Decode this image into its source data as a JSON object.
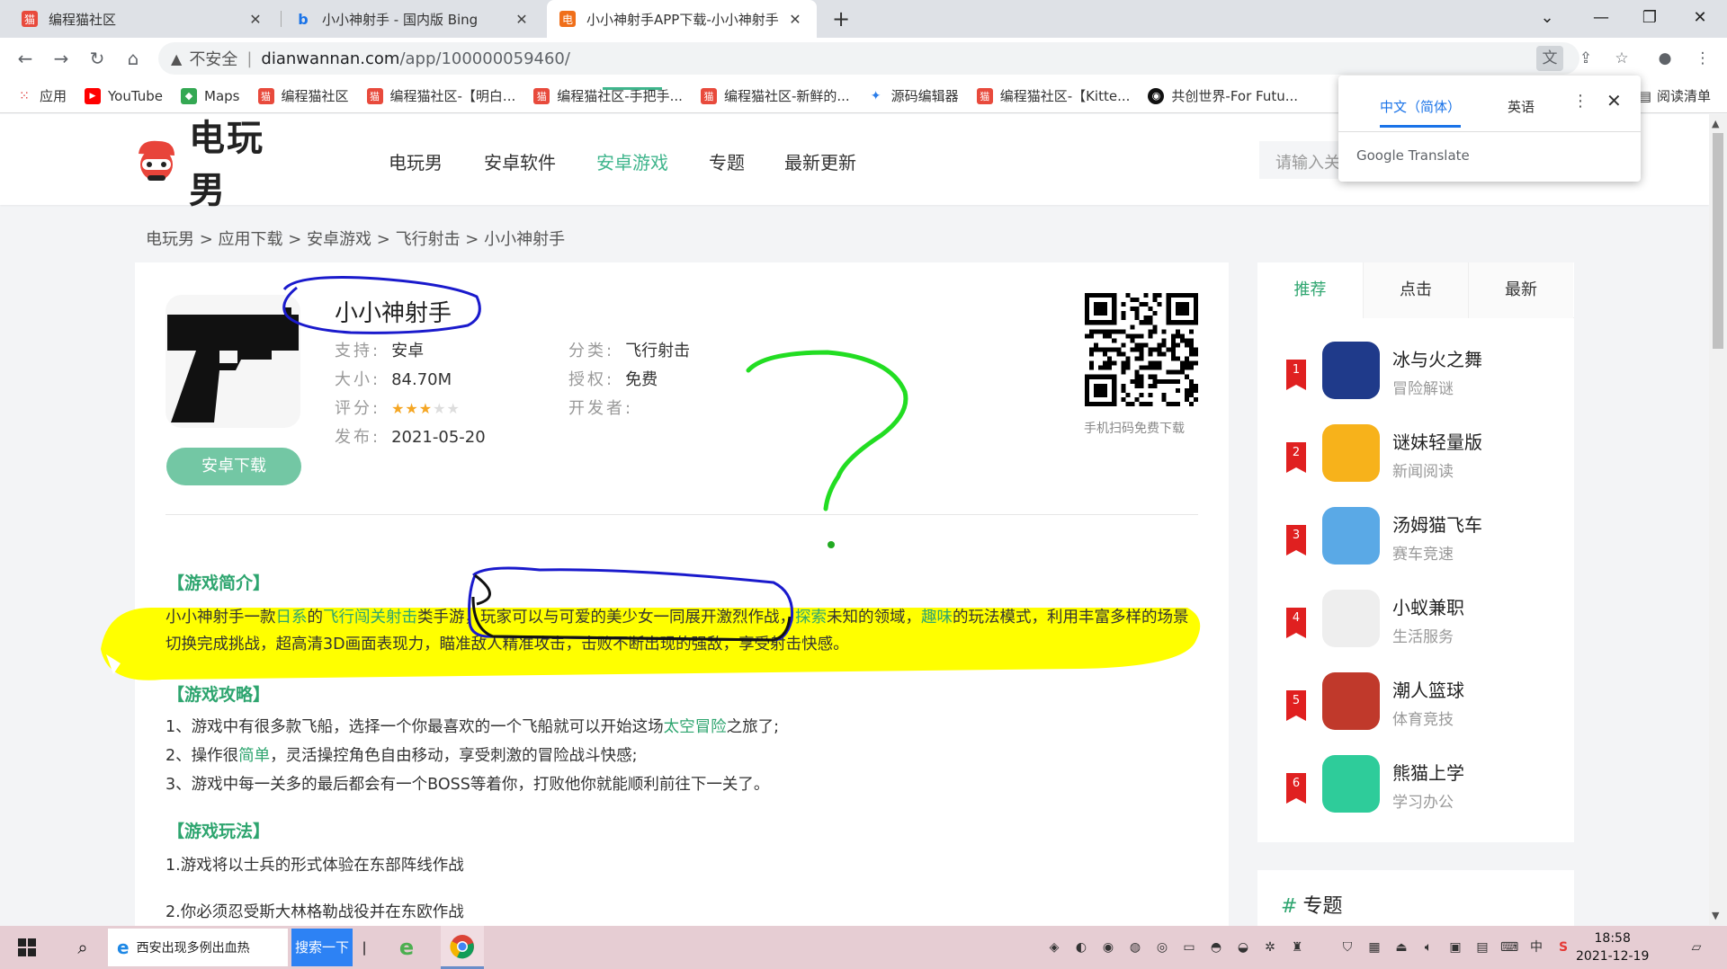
{
  "browser": {
    "tabs": [
      {
        "title": "编程猫社区",
        "active": false
      },
      {
        "title": "小小神射手 - 国内版 Bing",
        "active": false
      },
      {
        "title": "小小神射手APP下载-小小神射手",
        "active": true
      }
    ],
    "address": {
      "insecure_label": "不安全",
      "host": "dianwannan.com",
      "path": "/app/100000059460/"
    },
    "bookmarks": [
      {
        "label": "应用",
        "icon": "apps-grid-icon"
      },
      {
        "label": "YouTube",
        "icon": "youtube-icon"
      },
      {
        "label": "Maps",
        "icon": "maps-icon"
      },
      {
        "label": "编程猫社区",
        "icon": "codemao-icon"
      },
      {
        "label": "编程猫社区-【明白...",
        "icon": "codemao-icon"
      },
      {
        "label": "编程猫社区-手把手...",
        "icon": "codemao-icon"
      },
      {
        "label": "编程猫社区-新鲜的...",
        "icon": "codemao-icon"
      },
      {
        "label": "源码编辑器",
        "icon": "code-editor-icon"
      },
      {
        "label": "编程猫社区-【Kitte...",
        "icon": "codemao-icon"
      },
      {
        "label": "共创世界-For Futu...",
        "icon": "world-icon"
      }
    ],
    "reading_list": "阅读清单"
  },
  "translate_popup": {
    "tab_source": "中文（简体）",
    "tab_target": "英语",
    "brand": "Google Translate"
  },
  "site": {
    "logo_text": "电玩男",
    "nav": [
      "电玩男",
      "安卓软件",
      "安卓游戏",
      "专题",
      "最新更新"
    ],
    "active_nav": "安卓游戏",
    "search_placeholder": "请输入关"
  },
  "breadcrumb": "电玩男 > 应用下载 > 安卓游戏 > 飞行射击 > 小小神射手",
  "app": {
    "title": "小小神射手",
    "support_label": "支持:",
    "support": "安卓",
    "size_label": "大小:",
    "size": "84.70M",
    "rating_label": "评分:",
    "rating": 3,
    "rating_max": 5,
    "release_label": "发布:",
    "release": "2021-05-20",
    "category_label": "分类:",
    "category": "飞行射击",
    "license_label": "授权:",
    "license": "免费",
    "developer_label": "开发者:",
    "developer": "",
    "download_button": "安卓下载",
    "qr_caption": "手机扫码免费下载"
  },
  "content": {
    "intro_title": "【游戏简介】",
    "intro_p1": {
      "a": "小小神射手一款",
      "b": "日系",
      "c": "的",
      "d": "飞行闯关射击",
      "e": "类手游，玩家可以与可爱的美少女一同展开激烈作战，",
      "f": "探索",
      "g": "未知的领域，",
      "h": "趣味",
      "i": "的玩法模式，利用丰富多样的场景"
    },
    "intro_p2": "切换完成挑战，超高清3D画面表现力，瞄准敌人精准攻击，击败不断出现的强敌，享受射击快感。",
    "guide_title": "【游戏攻略】",
    "guide_1": {
      "a": "1、游戏中有很多款飞船，选择一个你最喜欢的一个飞船就可以开始这场",
      "b": "太空冒险",
      "c": "之旅了;"
    },
    "guide_2": {
      "a": "2、操作很",
      "b": "简单",
      "c": "，灵活操控角色自由移动，享受刺激的冒险战斗快感;"
    },
    "guide_3": "3、游戏中每一关多的最后都会有一个BOSS等着你，打败他你就能顺利前往下一关了。",
    "play_title": "【游戏玩法】",
    "play_1": "1.游戏将以士兵的形式体验在东部阵线作战",
    "play_2": "2.你必须忍受斯大林格勒战役并在东欧作战"
  },
  "sidebar": {
    "tabs": [
      "推荐",
      "点击",
      "最新"
    ],
    "apps": [
      {
        "rank": "1",
        "name": "冰与火之舞",
        "category": "冒险解谜",
        "color": "#1f3a8a"
      },
      {
        "rank": "2",
        "name": "谜妹轻量版",
        "category": "新闻阅读",
        "color": "#f7b21b"
      },
      {
        "rank": "3",
        "name": "汤姆猫飞车",
        "category": "赛车竞速",
        "color": "#5aa9e6"
      },
      {
        "rank": "4",
        "name": "小蚁兼职",
        "category": "生活服务",
        "color": "#eeeeee"
      },
      {
        "rank": "5",
        "name": "潮人篮球",
        "category": "体育竞技",
        "color": "#c0392b"
      },
      {
        "rank": "6",
        "name": "熊猫上学",
        "category": "学习办公",
        "color": "#2ecc9a"
      }
    ],
    "topic_title": "专题"
  },
  "taskbar": {
    "search_text": "西安出现多例出血热",
    "search_button": "搜索一下",
    "time": "18:58",
    "date": "2021-12-19"
  },
  "colors": {
    "accent": "#3fb58c",
    "highlight": "#ffff00",
    "annot_blue": "#1a1acc",
    "annot_green": "#22dd22"
  }
}
